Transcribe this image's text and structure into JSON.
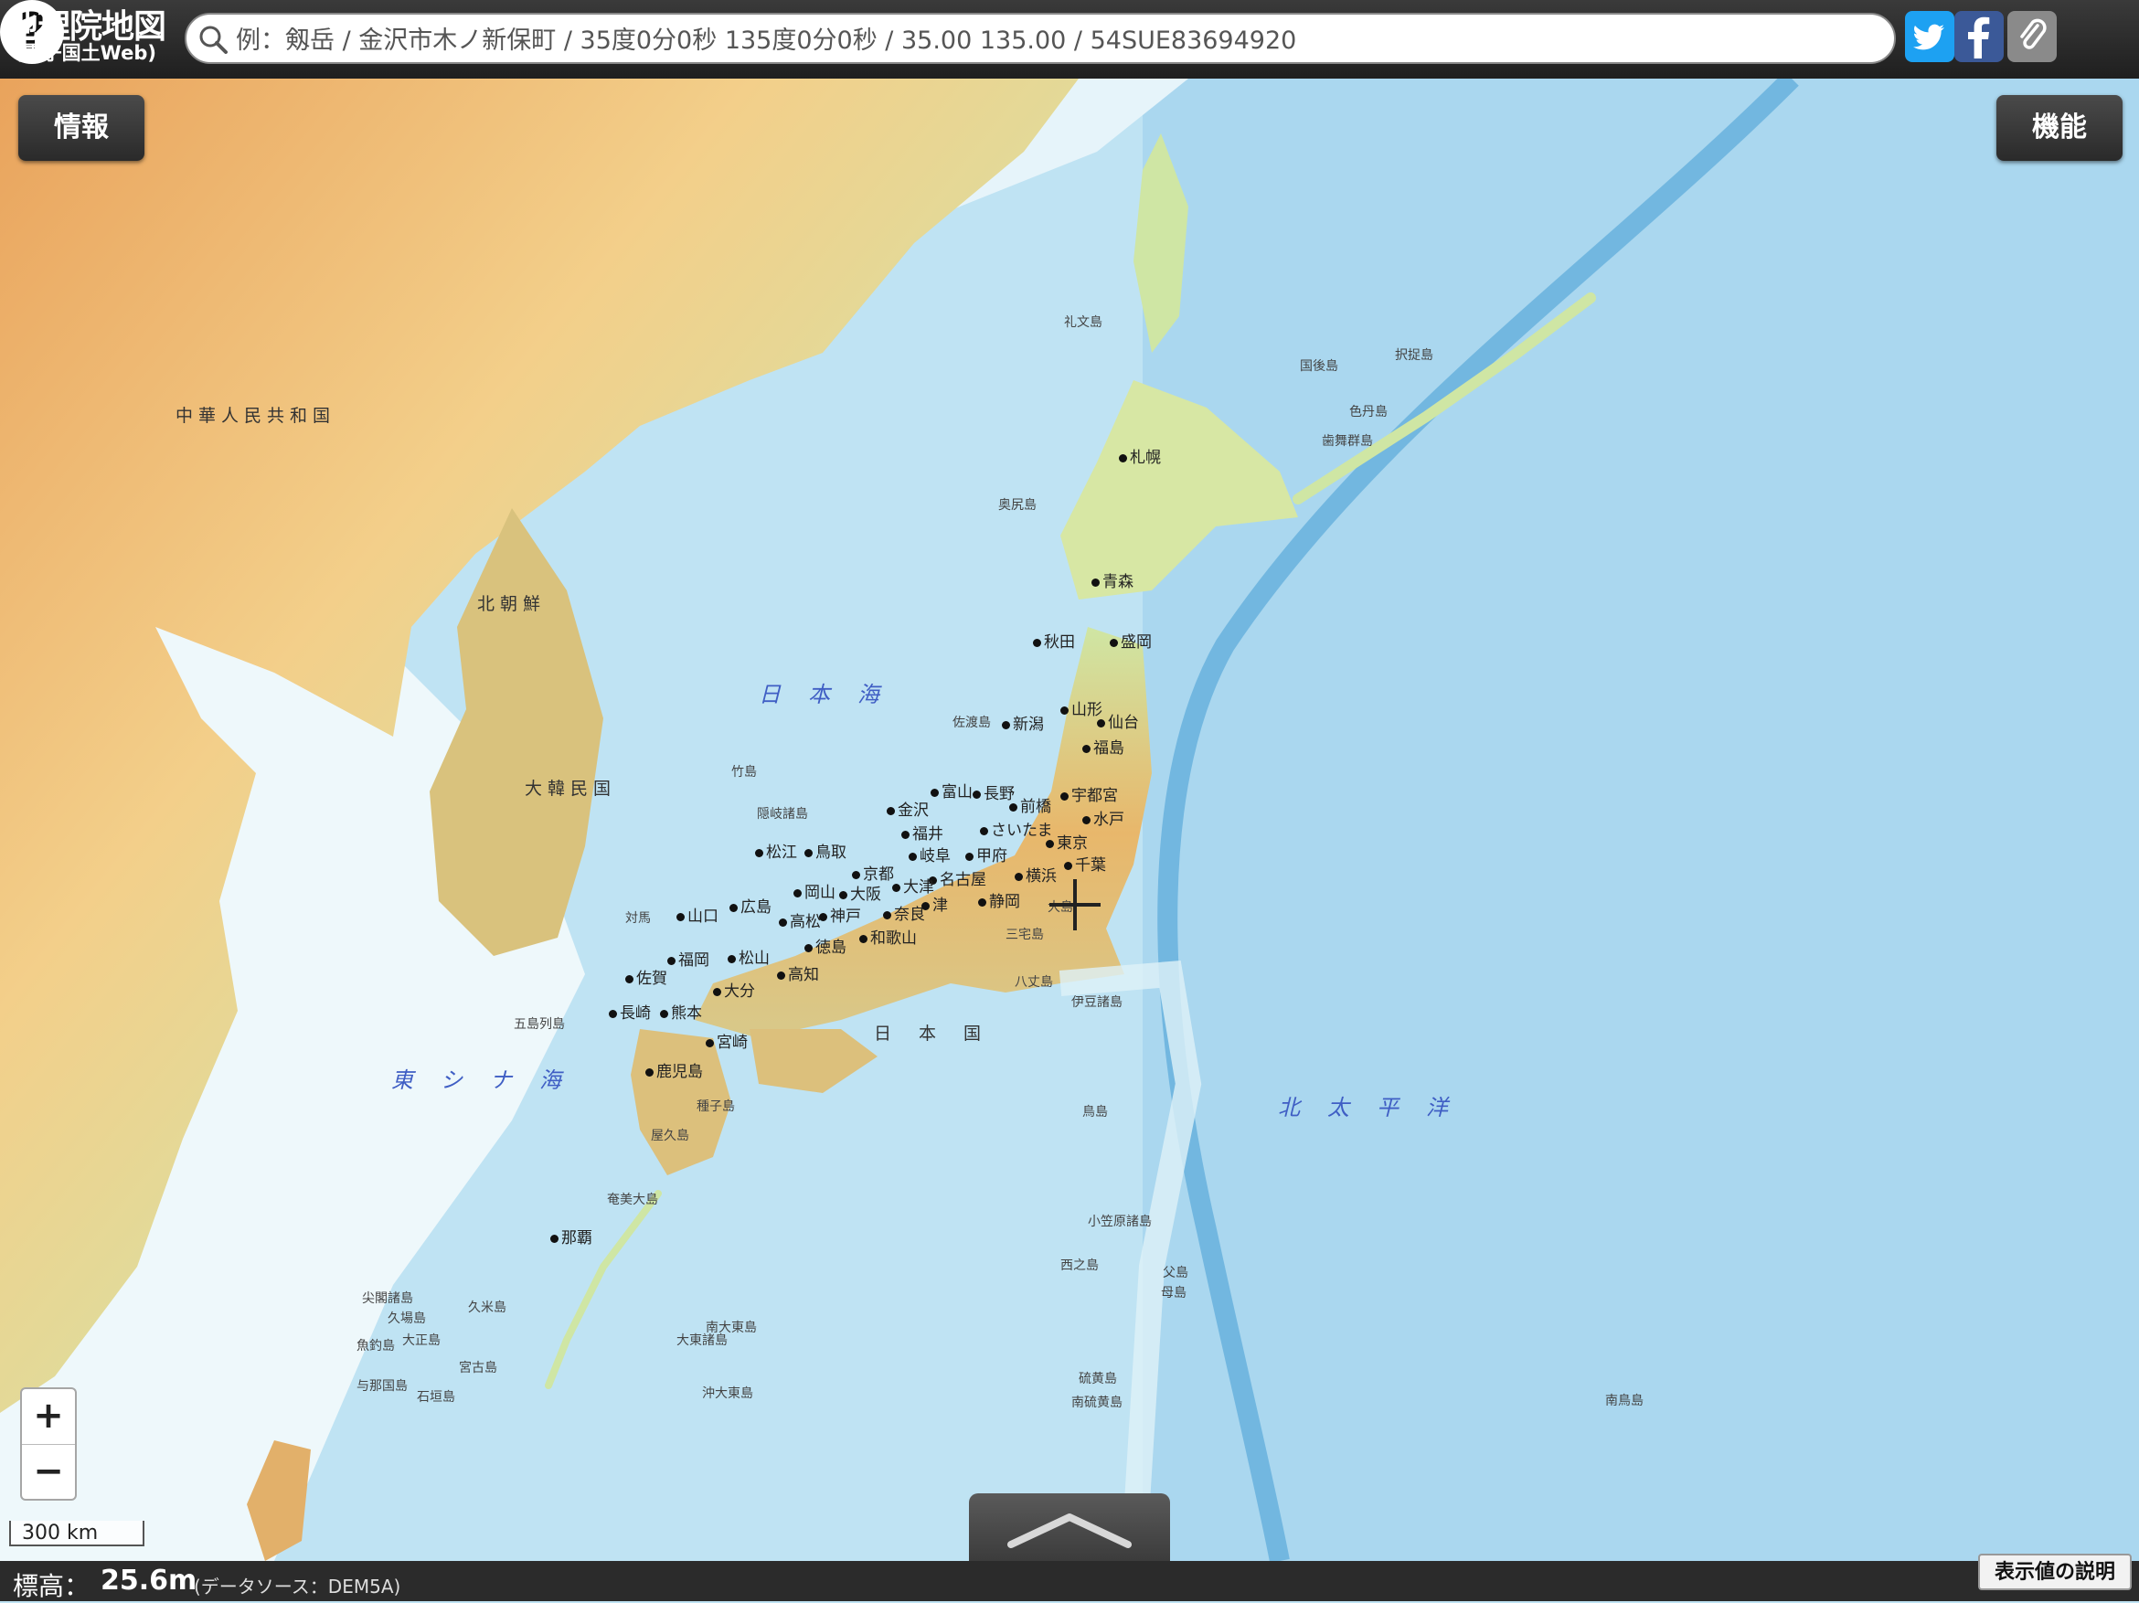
{
  "header": {
    "logo_title": "地理院地図",
    "logo_subtitle": "(電子国土Web)",
    "search_placeholder": "例：剱岳 / 金沢市木ノ新保町 / 35度0分0秒 135度0分0秒 / 35.00 135.00 / 54SUE83694920",
    "help_label": "?"
  },
  "buttons": {
    "info": "情報",
    "functions": "機能",
    "zoom_in": "+",
    "zoom_out": "−",
    "explain": "表示値の説明"
  },
  "scale_label": "300 km",
  "footer": {
    "elevation_label": "標高：",
    "elevation_value": "25.6m",
    "data_source": "(データソース：DEM5A)"
  },
  "colors": {
    "sea": "#bfe3f3",
    "deep_sea": "#8fc8e6",
    "lowland": "#c9e3a5",
    "highland": "#e9b46a",
    "header": "#2b2b2b",
    "twitter": "#1da1f2",
    "facebook": "#3b5998"
  },
  "map_labels": {
    "countries": [
      "中華人民共和国",
      "北朝鮮",
      "大韓民国",
      "日本国"
    ],
    "seas": [
      "日本海",
      "東シナ海",
      "北太平洋"
    ],
    "cities": [
      "札幌",
      "青森",
      "秋田",
      "盛岡",
      "山形",
      "仙台",
      "新潟",
      "福島",
      "宇都宮",
      "前橋",
      "水戸",
      "さいたま",
      "東京",
      "千葉",
      "横浜",
      "甲府",
      "長野",
      "富山",
      "金沢",
      "福井",
      "岐阜",
      "名古屋",
      "静岡",
      "津",
      "大津",
      "京都",
      "奈良",
      "大阪",
      "和歌山",
      "神戸",
      "鳥取",
      "松江",
      "岡山",
      "広島",
      "山口",
      "高松",
      "徳島",
      "高知",
      "松山",
      "福岡",
      "佐賀",
      "長崎",
      "熊本",
      "大分",
      "宮崎",
      "鹿児島",
      "那覇"
    ],
    "islands": [
      "礼文島",
      "奥尻島",
      "国後島",
      "択捉島",
      "色丹島",
      "歯舞群島",
      "佐渡島",
      "竹島",
      "隠岐諸島",
      "対馬",
      "五島列島",
      "種子島",
      "屋久島",
      "奄美大島",
      "三宅島",
      "八丈島",
      "鳥島",
      "伊豆諸島",
      "大島",
      "西之島",
      "父島",
      "母島",
      "硫黄島",
      "南硫黄島",
      "南鳥島",
      "南大東島",
      "沖大東島",
      "大東諸島",
      "久米島",
      "宮古島",
      "石垣島",
      "与那国島",
      "大正島",
      "魚釣島",
      "久場島",
      "尖閣諸島",
      "小笠原諸島"
    ]
  }
}
